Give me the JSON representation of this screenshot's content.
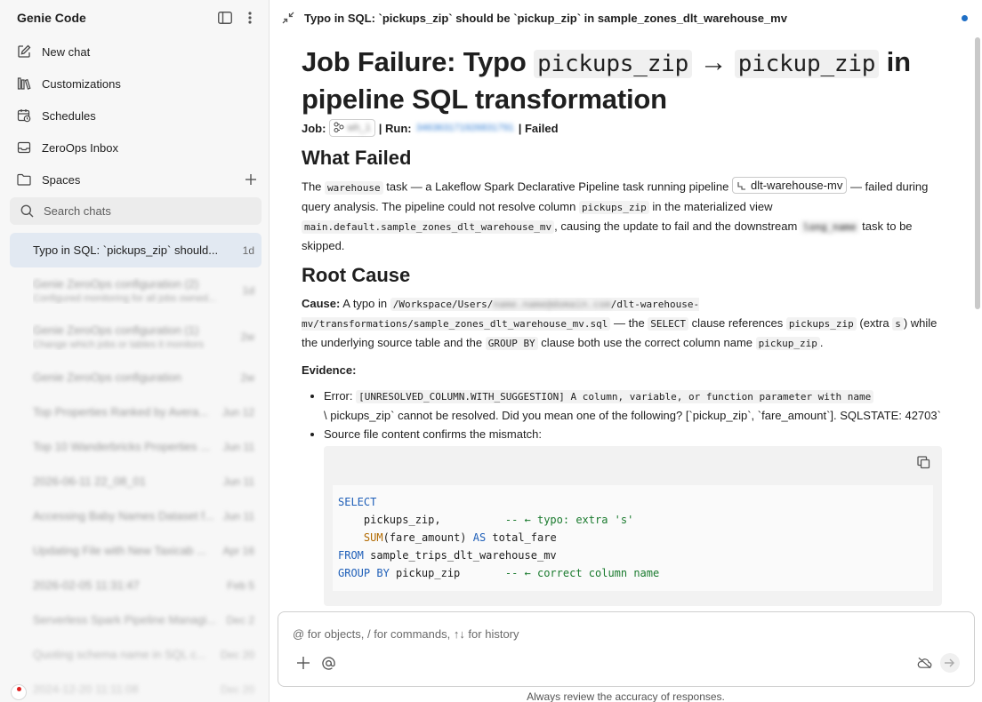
{
  "sidebar": {
    "title": "Genie Code",
    "nav": [
      {
        "label": "New chat",
        "icon": "edit-icon"
      },
      {
        "label": "Customizations",
        "icon": "library-icon"
      },
      {
        "label": "Schedules",
        "icon": "calendar-clock-icon"
      },
      {
        "label": "ZeroOps Inbox",
        "icon": "inbox-icon"
      }
    ],
    "spaces_label": "Spaces",
    "search_placeholder": "Search chats",
    "active_chat": {
      "title": "Typo in SQL: `pickups_zip` should...",
      "age": "1d"
    },
    "chats": [
      {
        "title": "Genie ZeroOps configuration (2)",
        "sub": "Configured monitoring for all jobs owned...",
        "age": "1d"
      },
      {
        "title": "Genie ZeroOps configuration (1)",
        "sub": "Change which jobs or tables it monitors",
        "age": "2w"
      },
      {
        "title": "Genie ZeroOps configuration",
        "age": "2w"
      },
      {
        "title": "Top Properties Ranked by Avera...",
        "age": "Jun 12"
      },
      {
        "title": "Top 10 Wanderbricks Properties ...",
        "age": "Jun 11"
      },
      {
        "title": "2026-06-11 22_08_01",
        "age": "Jun 11"
      },
      {
        "title": "Accessing Baby Names Dataset f...",
        "age": "Jun 11"
      },
      {
        "title": "Updating File with New Taxicab ...",
        "age": "Apr 16"
      },
      {
        "title": "2026-02-05 11:31:47",
        "age": "Feb 5"
      },
      {
        "title": "Serverless Spark Pipeline Managi...",
        "age": "Dec 2"
      },
      {
        "title": "Quoting schema name in SQL c...",
        "age": "Dec 20"
      },
      {
        "title": "2024-12-20 11:11:08",
        "age": "Dec 20"
      }
    ]
  },
  "topbar": {
    "title": "Typo in SQL: `pickups_zip` should be `pickup_zip` in sample_zones_dlt_warehouse_mv"
  },
  "doc": {
    "h1_pre": "Job Failure: Typo ",
    "h1_code1": "pickups_zip",
    "h1_arrow": " → ",
    "h1_code2": "pickup_zip",
    "h1_post": " in pipeline SQL transformation",
    "job_label": "Job:",
    "job_name": "wh_1",
    "run_label": "| Run:",
    "run_id": "346363171926831791",
    "status": "| Failed",
    "what_failed_h": "What Failed",
    "wf_1": "The ",
    "wf_code1": "warehouse",
    "wf_2": " task — a Lakeflow Spark Declarative Pipeline task running pipeline ",
    "wf_pipeline": "dlt-warehouse-mv",
    "wf_3": " — failed during query analysis. The pipeline could not resolve column ",
    "wf_code2": "pickups_zip",
    "wf_4": " in the materialized view ",
    "wf_code3": "main.default.sample_zones_dlt_warehouse_mv",
    "wf_5": ", causing the update to fail and the downstream ",
    "wf_blur": "long_name",
    "wf_6": " task to be skipped.",
    "root_cause_h": "Root Cause",
    "rc_label": "Cause:",
    "rc_1": " A typo in ",
    "rc_path_a": "/Workspace/Users/",
    "rc_path_blur": "name.name@domain.com",
    "rc_path_b": "/dlt-warehouse-mv/transformations/sample_zones_dlt_warehouse_mv.sql",
    "rc_2": " — the ",
    "rc_code_select": "SELECT",
    "rc_3": " clause references ",
    "rc_code_pickups": "pickups_zip",
    "rc_4": " (extra ",
    "rc_code_s": "s",
    "rc_5": ") while the underlying source table and the ",
    "rc_code_groupby": "GROUP BY",
    "rc_6": " clause both use the correct column name ",
    "rc_code_pickup": "pickup_zip",
    "rc_7": ".",
    "evidence_label": "Evidence:",
    "ev1_label": "Error: ",
    "ev1_code": "[UNRESOLVED_COLUMN.WITH_SUGGESTION] A column, variable, or function parameter with name",
    "ev1_rest": "\\ pickups_zip` cannot be resolved. Did you mean one of the following? [`pickup_zip`, `fare_amount`]. SQLSTATE: 42703`",
    "ev2": "Source file content confirms the mismatch:",
    "code_lines": [
      {
        "kw": "SELECT",
        "rest": ""
      },
      {
        "plain": "    pickups_zip,          ",
        "cm": "-- ← typo: extra 's'"
      },
      {
        "indent": "    ",
        "fn": "SUM",
        "plain": "(fare_amount) ",
        "kw": "AS",
        "rest": " total_fare"
      },
      {
        "kw": "FROM",
        "rest": " sample_trips_dlt_warehouse_mv"
      },
      {
        "kw": "GROUP BY",
        "rest": " pickup_zip       ",
        "cm": "-- ← correct column name"
      }
    ]
  },
  "composer": {
    "placeholder": "@ for objects, / for commands, ↑↓ for history",
    "footer": "Always review the accuracy of responses."
  }
}
